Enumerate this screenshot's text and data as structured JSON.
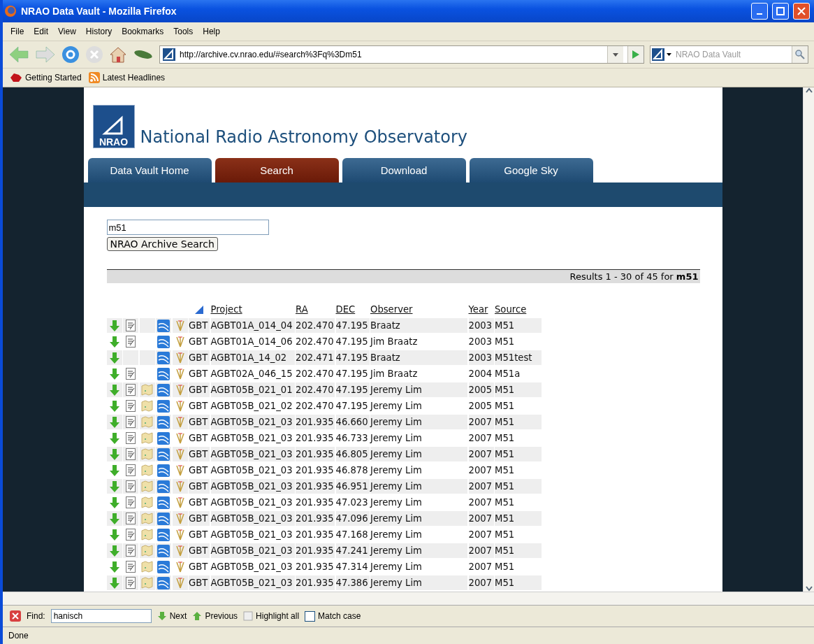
{
  "window": {
    "title": "NRAO Data Vault - Mozilla Firefox"
  },
  "menu": [
    "File",
    "Edit",
    "View",
    "History",
    "Bookmarks",
    "Tools",
    "Help"
  ],
  "address": {
    "value": "http://archive.cv.nrao.edu/#search%3Fq%3Dm51"
  },
  "search_box": {
    "placeholder": "NRAO Data Vault"
  },
  "bookmarks": [
    {
      "label": "Getting Started",
      "kind": "page"
    },
    {
      "label": "Latest Headlines",
      "kind": "feed"
    }
  ],
  "site": {
    "title": "National Radio Astronomy Observatory",
    "logo": "NRAO",
    "tabs": [
      {
        "label": "Data Vault Home",
        "selected": false
      },
      {
        "label": "Search",
        "selected": true
      },
      {
        "label": "Download",
        "selected": false
      },
      {
        "label": "Google Sky",
        "selected": false
      }
    ]
  },
  "query": {
    "value": "m51",
    "button": "NRAO Archive Search"
  },
  "results": {
    "summary": "Results 1 - 30 of 45 for **m51**"
  },
  "table": {
    "columns": [
      {
        "kind": "icon"
      },
      {
        "kind": "text",
        "label": "Project"
      },
      {
        "kind": "text",
        "label": "RA"
      },
      {
        "kind": "text",
        "label": "DEC"
      },
      {
        "kind": "text",
        "label": "Observer"
      },
      {
        "kind": "text",
        "label": "Year"
      },
      {
        "kind": "text",
        "label": "Source"
      }
    ],
    "rows": [
      {
        "notes": true,
        "map": false,
        "cells": [
          "GBT",
          "AGBT01A_014_04",
          "202.470",
          "47.195",
          "Braatz",
          "2003",
          "M51"
        ]
      },
      {
        "notes": true,
        "map": false,
        "cells": [
          "GBT",
          "AGBT01A_014_06",
          "202.470",
          "47.195",
          "Jim Braatz",
          "2003",
          "M51"
        ]
      },
      {
        "notes": false,
        "map": false,
        "cells": [
          "GBT",
          "AGBT01A_14_02",
          "202.471",
          "47.195",
          "Braatz",
          "2003",
          "M51test"
        ]
      },
      {
        "notes": true,
        "map": false,
        "cells": [
          "GBT",
          "AGBT02A_046_15",
          "202.470",
          "47.195",
          "Jim Braatz",
          "2004",
          "M51a"
        ]
      },
      {
        "notes": true,
        "map": true,
        "cells": [
          "GBT",
          "AGBT05B_021_01",
          "202.470",
          "47.195",
          "Jeremy Lim",
          "2005",
          "M51"
        ]
      },
      {
        "notes": true,
        "map": true,
        "cells": [
          "GBT",
          "AGBT05B_021_02",
          "202.470",
          "47.195",
          "Jeremy Lim",
          "2005",
          "M51"
        ]
      },
      {
        "notes": true,
        "map": true,
        "cells": [
          "GBT",
          "AGBT05B_021_03",
          "201.935",
          "46.660",
          "Jeremy Lim",
          "2007",
          "M51"
        ]
      },
      {
        "notes": true,
        "map": true,
        "cells": [
          "GBT",
          "AGBT05B_021_03",
          "201.935",
          "46.733",
          "Jeremy Lim",
          "2007",
          "M51"
        ]
      },
      {
        "notes": true,
        "map": true,
        "cells": [
          "GBT",
          "AGBT05B_021_03",
          "201.935",
          "46.805",
          "Jeremy Lim",
          "2007",
          "M51"
        ]
      },
      {
        "notes": true,
        "map": true,
        "cells": [
          "GBT",
          "AGBT05B_021_03",
          "201.935",
          "46.878",
          "Jeremy Lim",
          "2007",
          "M51"
        ]
      },
      {
        "notes": true,
        "map": true,
        "cells": [
          "GBT",
          "AGBT05B_021_03",
          "201.935",
          "46.951",
          "Jeremy Lim",
          "2007",
          "M51"
        ]
      },
      {
        "notes": true,
        "map": true,
        "cells": [
          "GBT",
          "AGBT05B_021_03",
          "201.935",
          "47.023",
          "Jeremy Lim",
          "2007",
          "M51"
        ]
      },
      {
        "notes": true,
        "map": true,
        "cells": [
          "GBT",
          "AGBT05B_021_03",
          "201.935",
          "47.096",
          "Jeremy Lim",
          "2007",
          "M51"
        ]
      },
      {
        "notes": true,
        "map": true,
        "cells": [
          "GBT",
          "AGBT05B_021_03",
          "201.935",
          "47.168",
          "Jeremy Lim",
          "2007",
          "M51"
        ]
      },
      {
        "notes": true,
        "map": true,
        "cells": [
          "GBT",
          "AGBT05B_021_03",
          "201.935",
          "47.241",
          "Jeremy Lim",
          "2007",
          "M51"
        ]
      },
      {
        "notes": true,
        "map": true,
        "cells": [
          "GBT",
          "AGBT05B_021_03",
          "201.935",
          "47.314",
          "Jeremy Lim",
          "2007",
          "M51"
        ]
      },
      {
        "notes": true,
        "map": true,
        "cells": [
          "GBT",
          "AGBT05B_021_03",
          "201.935",
          "47.386",
          "Jeremy Lim",
          "2007",
          "M51"
        ]
      }
    ]
  },
  "find_bar": {
    "label": "Find:",
    "value": "hanisch",
    "next": "Next",
    "previous": "Previous",
    "highlight": "Highlight all",
    "match_case": {
      "label": "Match case",
      "checked": false
    }
  },
  "status_bar": "Done"
}
